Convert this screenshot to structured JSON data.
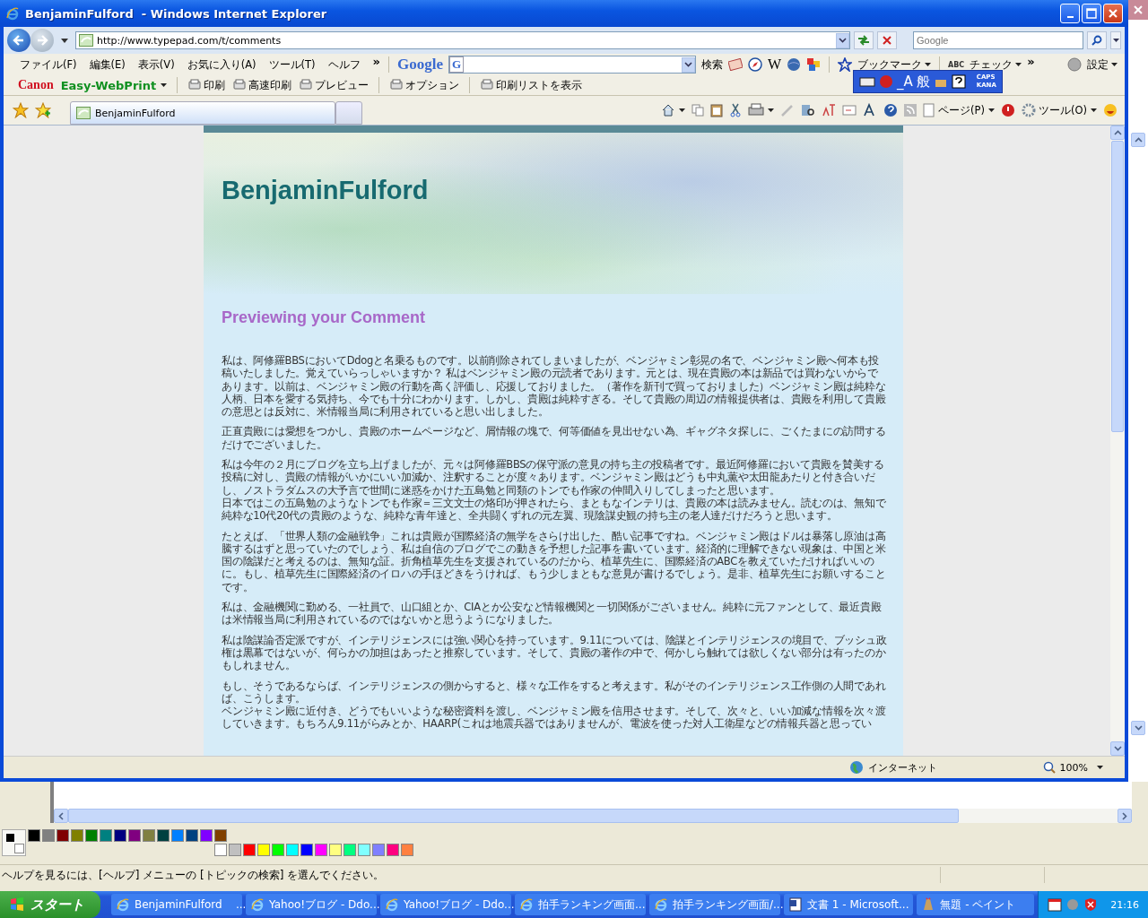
{
  "browser": {
    "title": "BenjaminFulford  - Windows Internet Explorer",
    "address": "http://www.typepad.com/t/comments",
    "search_placeholder": "Google",
    "menu": [
      "ファイル(F)",
      "編集(E)",
      "表示(V)",
      "お気に入り(A)",
      "ツール(T)",
      "ヘルフ"
    ],
    "menu_overflow": "»",
    "google_toolbar": {
      "logo": "Google",
      "field_icon": "G",
      "wikipedia": "W",
      "search_button": "検索",
      "bookmarks": "ブックマーク",
      "check": "チェック",
      "check_badge": "ABC",
      "overflow": "»",
      "settings": "設定"
    },
    "ime_bar": {
      "mode": "_A",
      "dictionary": "般",
      "caps": "CAPS",
      "kana": "KANA"
    },
    "print_toolbar": {
      "brand": "Canon",
      "product": "Easy-WebPrint",
      "buttons": [
        "印刷",
        "高速印刷",
        "プレビュー",
        "オプション",
        "印刷リストを表示"
      ]
    },
    "tabs": [
      {
        "label": "BenjaminFulford",
        "selected": true
      }
    ],
    "command_bar": {
      "page": "ページ(P)",
      "tools": "ツール(O)"
    },
    "status": {
      "zone": "インターネット",
      "zoom": "100%"
    }
  },
  "page": {
    "blog_title": "BenjaminFulford",
    "heading": "Previewing your Comment",
    "paragraphs": [
      [
        "私は、阿修羅BBSにおいてDdogと名乗るものです。以前削除されてしまいましたが、ベンジャミン彰晃の名で、ベンジャミン殿へ何本も投稿いたしました。覚えていらっしゃいますか？ 私はベンジャミン殿の元読者であります。元とは、現在貴殿の本は新品では買わないからであります。以前は、ベンジャミン殿の行動を高く評価し、応援しておりました。（著作を新刊で買っておりました）ベンジャミン殿は純粋な人柄、日本を愛する気持ち、今でも十分にわかります。しかし、貴殿は純粋すぎる。そして貴殿の周辺の情報提供者は、貴殿を利用して貴殿の意思とは反対に、米情報当局に利用されていると思い出しました。"
      ],
      [
        "正直貴殿には愛想をつかし、貴殿のホームページなど、屑情報の塊で、何等価値を見出せない為、ギャグネタ探しに、ごくたまにの訪問するだけでございました。"
      ],
      [
        "私は今年の２月にブログを立ち上げましたが、元々は阿修羅BBSの保守派の意見の持ち主の投稿者です。最近阿修羅において貴殿を賛美する投稿に対し、貴殿の情報がいかにいい加減か、注釈することが度々あります。ベンジャミン殿はどうも中丸薫や太田龍あたりと付き合いだし、ノストラダムスの大予言で世間に迷惑をかけた五島勉と同類のトンでも作家の仲間入りしてしまったと思います。",
        "日本ではこの五島勉のようなトンでも作家＝三文文士の烙印が押されたら、まともなインテリは、貴殿の本は読みません。読むのは、無知で純粋な10代20代の貴殿のような、純粋な青年達と、全共闘くずれの元左翼、現陰謀史観の持ち主の老人達だけだろうと思います。"
      ],
      [
        "たとえば、「世界人類の金融戦争」これは貴殿が国際経済の無学をさらけ出した、酷い記事ですね。ベンジャミン殿はドルは暴落し原油は高騰するはずと思っていたのでしょう、私は自信のブログでこの動きを予想した記事を書いています。経済的に理解できない現象は、中国と米国の陰謀だと考えるのは、無知な証。折角植草先生を支援されているのだから、植草先生に、国際経済のABCを教えていただければいいのに。もし、植草先生に国際経済のイロハの手ほどきをうければ、もう少しまともな意見が書けるでしょう。是非、植草先生にお願いすることです。"
      ],
      [
        "私は、金融機関に勤める、一社員で、山口組とか、CIAとか公安など情報機関と一切関係がございません。純粋に元ファンとして、最近貴殿は米情報当局に利用されているのではないかと思うようになりました。"
      ],
      [
        "私は陰謀論否定派ですが、インテリジェンスには強い関心を持っています。9.11については、陰謀とインテリジェンスの境目で、ブッシュ政権は黒幕ではないが、何らかの加担はあったと推察しています。そして、貴殿の著作の中で、何かしら触れては欲しくない部分は有ったのかもしれません。"
      ],
      [
        "もし、そうであるならば、インテリジェンスの側からすると、様々な工作をすると考えます。私がそのインテリジェンス工作側の人間であれば、こうします。",
        "ベンジャミン殿に近付き、どうでもいいような秘密資料を渡し、ベンジャミン殿を信用させます。そして、次々と、いい加減な情報を次々渡していきます。もちろん9.11がらみとか、HAARP(これは地震兵器ではありませんが、電波を使った対人工衛星などの情報兵器と思ってい"
      ]
    ]
  },
  "paint": {
    "foreground": {
      "color": "#000000"
    },
    "background": {
      "color": "#ffffff"
    },
    "palette": [
      {
        "color": "#000000"
      },
      {
        "color": "#808080"
      },
      {
        "color": "#800000"
      },
      {
        "color": "#808000"
      },
      {
        "color": "#008000"
      },
      {
        "color": "#008080"
      },
      {
        "color": "#000080"
      },
      {
        "color": "#800080"
      },
      {
        "color": "#808040"
      },
      {
        "color": "#004040"
      },
      {
        "color": "#0080ff"
      },
      {
        "color": "#004080"
      },
      {
        "color": "#8000ff"
      },
      {
        "color": "#804000"
      },
      {
        "color": "#ffffff"
      },
      {
        "color": "#c0c0c0"
      },
      {
        "color": "#ff0000"
      },
      {
        "color": "#ffff00"
      },
      {
        "color": "#00ff00"
      },
      {
        "color": "#00ffff"
      },
      {
        "color": "#0000ff"
      },
      {
        "color": "#ff00ff"
      },
      {
        "color": "#ffff80"
      },
      {
        "color": "#00ff80"
      },
      {
        "color": "#80ffff"
      },
      {
        "color": "#8080ff"
      },
      {
        "color": "#ff0080"
      },
      {
        "color": "#ff8040"
      }
    ],
    "status": "ヘルプを見るには、[ヘルプ] メニューの [トピックの検索] を選んでください。"
  },
  "taskbar": {
    "start": "スタート",
    "items": [
      {
        "kind": "ie",
        "label": "BenjaminFulford    ..."
      },
      {
        "kind": "ie",
        "label": "Yahoo!ブログ - Ddo..."
      },
      {
        "kind": "ie",
        "label": "Yahoo!ブログ - Ddo..."
      },
      {
        "kind": "ie",
        "label": "拍手ランキング画面..."
      },
      {
        "kind": "ie",
        "label": "拍手ランキング画面/..."
      },
      {
        "kind": "word",
        "label": "文書 1 - Microsoft..."
      },
      {
        "kind": "paint",
        "label": "無題 - ペイント"
      }
    ],
    "clock": "21:16"
  }
}
